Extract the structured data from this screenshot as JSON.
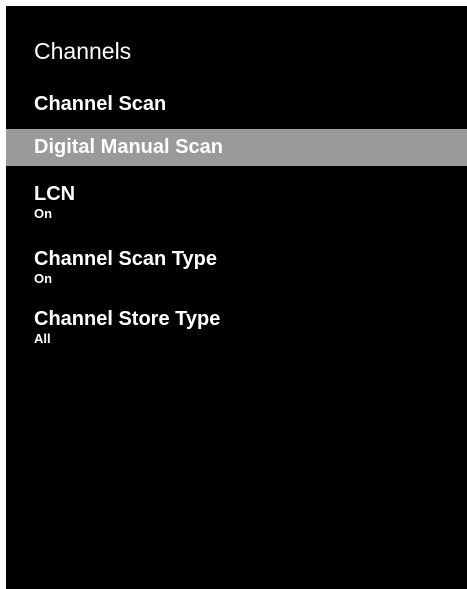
{
  "menu": {
    "title": "Channels",
    "items": [
      {
        "label": "Channel Scan"
      },
      {
        "label": "Digital Manual Scan",
        "selected": true
      },
      {
        "label": "LCN",
        "value": "On"
      },
      {
        "label": "Channel Scan Type",
        "value": "On"
      },
      {
        "label": "Channel Store Type",
        "value": "All"
      }
    ]
  },
  "colors": {
    "background": "#000000",
    "text": "#ffffff",
    "highlight": "#9a9a9a"
  }
}
